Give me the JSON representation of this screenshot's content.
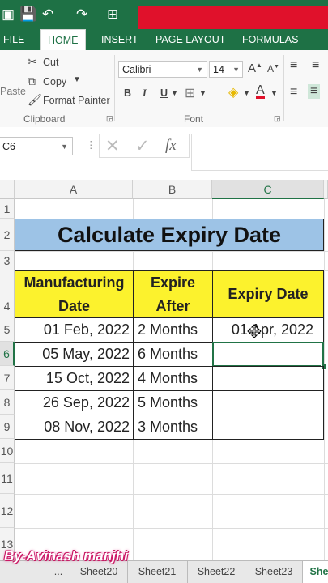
{
  "ribbon_tabs": [
    "FILE",
    "HOME",
    "INSERT",
    "PAGE LAYOUT",
    "FORMULAS"
  ],
  "clipboard": {
    "cut": "Cut",
    "copy": "Copy",
    "format_painter": "Format Painter",
    "paste": "Paste",
    "group_label": "Clipboard"
  },
  "font": {
    "family": "Calibri",
    "size": "14",
    "group_label": "Font",
    "bold": "B",
    "italic": "I",
    "underline": "U"
  },
  "formula_bar": {
    "name_box": "C6",
    "fx": "fx",
    "value": ""
  },
  "columns": [
    "A",
    "B",
    "C"
  ],
  "rows": [
    "1",
    "2",
    "3",
    "4",
    "5",
    "6",
    "7",
    "8",
    "9",
    "10",
    "11",
    "12",
    "13"
  ],
  "sheet": {
    "title": "Calculate Expiry Date",
    "headers": {
      "a": "Manufacturing Date",
      "b": "Expire After",
      "c": "Expiry Date"
    },
    "data": [
      {
        "mfg": "01 Feb, 2022",
        "after": "2 Months",
        "expiry": "01 Apr, 2022"
      },
      {
        "mfg": "05 May, 2022",
        "after": "6 Months",
        "expiry": ""
      },
      {
        "mfg": "15 Oct, 2022",
        "after": "4 Months",
        "expiry": ""
      },
      {
        "mfg": "26 Sep, 2022",
        "after": "5 Months",
        "expiry": ""
      },
      {
        "mfg": "08 Nov, 2022",
        "after": "3 Months",
        "expiry": ""
      }
    ]
  },
  "sheet_tabs": [
    "...",
    "Sheet20",
    "Sheet21",
    "Sheet22",
    "Sheet23",
    "She"
  ],
  "watermark": "By-Avinash manjhi",
  "colors": {
    "excel_green": "#1e7145",
    "title_fill": "#9dc3e6",
    "header_fill": "#fcf22d",
    "red_bar": "#e0112b"
  }
}
